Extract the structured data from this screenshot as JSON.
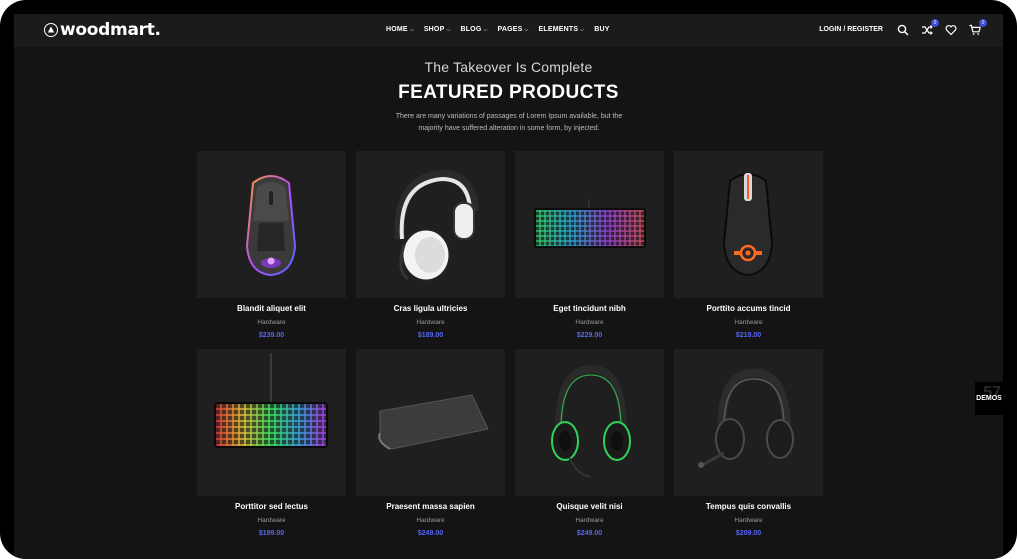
{
  "header": {
    "logo": "woodmart.",
    "nav": [
      {
        "label": "HOME",
        "dropdown": true
      },
      {
        "label": "SHOP",
        "dropdown": true
      },
      {
        "label": "BLOG",
        "dropdown": true
      },
      {
        "label": "PAGES",
        "dropdown": true
      },
      {
        "label": "ELEMENTS",
        "dropdown": true
      },
      {
        "label": "BUY",
        "dropdown": false
      }
    ],
    "login_label": "LOGIN / REGISTER",
    "compare_count": "0",
    "cart_count": "0",
    "icons": [
      "search-icon",
      "compare-icon",
      "heart-icon",
      "cart-icon"
    ]
  },
  "section": {
    "tagline": "The Takeover Is Complete",
    "title": "FEATURED PRODUCTS",
    "description_line1": "There are many variations of passages of Lorem Ipsum available, but the",
    "description_line2": "majority have suffered alteration in some form, by injected."
  },
  "products": [
    {
      "name": "Blandit aliquet elit",
      "category": "Hardware",
      "price": "$239.00",
      "image": "gaming-mouse"
    },
    {
      "name": "Cras ligula ultricies",
      "category": "Hardware",
      "price": "$189.00",
      "image": "white-headset"
    },
    {
      "name": "Eget tincidunt nibh",
      "category": "Hardware",
      "price": "$229.00",
      "image": "rgb-keyboard"
    },
    {
      "name": "Porttito accums tincid",
      "category": "Hardware",
      "price": "$219.00",
      "image": "steelseries-mouse"
    },
    {
      "name": "Porttitor sed lectus",
      "category": "Hardware",
      "price": "$199.00",
      "image": "tkl-keyboard"
    },
    {
      "name": "Praesent massa sapien",
      "category": "Hardware",
      "price": "$249.00",
      "image": "mousepad"
    },
    {
      "name": "Quisque velit nisi",
      "category": "Hardware",
      "price": "$249.00",
      "image": "green-headset"
    },
    {
      "name": "Tempus quis convallis",
      "category": "Hardware",
      "price": "$209.00",
      "image": "black-headset"
    }
  ],
  "demos_tab": {
    "label": "DEMOS",
    "number": "57"
  },
  "colors": {
    "accent": "#5966f3",
    "background": "#141414",
    "card": "#1f1f1f"
  }
}
